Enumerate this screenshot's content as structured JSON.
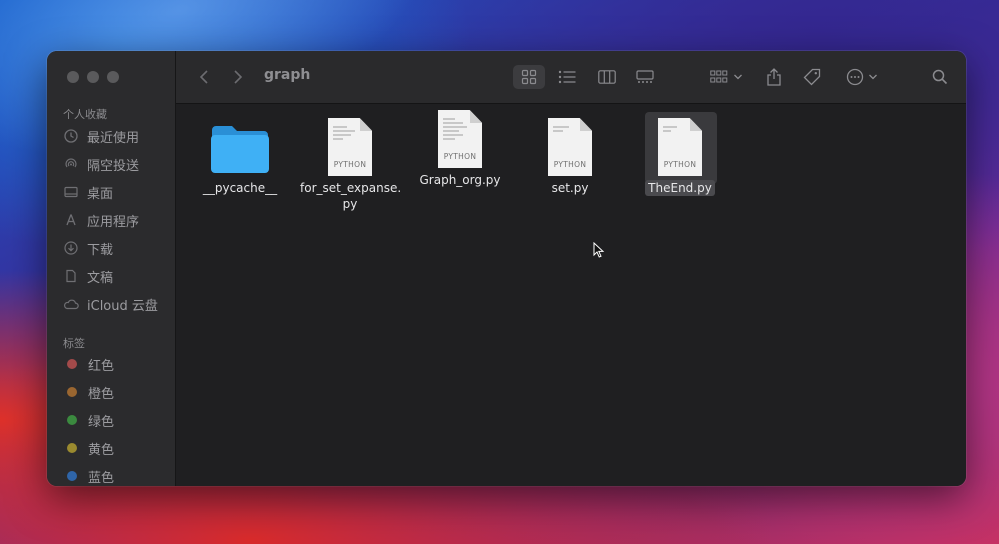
{
  "window": {
    "title": "graph"
  },
  "sidebar": {
    "favorites_title": "个人收藏",
    "favorites": [
      {
        "label": "最近使用",
        "icon": "clock-icon"
      },
      {
        "label": "隔空投送",
        "icon": "airdrop-icon"
      },
      {
        "label": "桌面",
        "icon": "desktop-icon"
      },
      {
        "label": "应用程序",
        "icon": "applications-icon"
      },
      {
        "label": "下载",
        "icon": "download-icon"
      },
      {
        "label": "文稿",
        "icon": "document-icon"
      },
      {
        "label": "iCloud 云盘",
        "icon": "cloud-icon"
      }
    ],
    "tags_title": "标签",
    "tags": [
      {
        "label": "红色",
        "color": "#a34a4a"
      },
      {
        "label": "橙色",
        "color": "#9a6630"
      },
      {
        "label": "绿色",
        "color": "#3b8a3f"
      },
      {
        "label": "黄色",
        "color": "#9a8a2f"
      },
      {
        "label": "蓝色",
        "color": "#2f65a8"
      }
    ]
  },
  "files": [
    {
      "name": "__pycache__",
      "kind": "folder"
    },
    {
      "name": "for_set_expanse.\npy",
      "kind": "python",
      "type_label": "PYTHON"
    },
    {
      "name": "Graph_org.py",
      "kind": "python",
      "type_label": "PYTHON"
    },
    {
      "name": "set.py",
      "kind": "python",
      "type_label": "PYTHON"
    },
    {
      "name": "TheEnd.py",
      "kind": "python",
      "type_label": "PYTHON",
      "selected": true
    }
  ],
  "colors": {
    "folder": "#3fb0f5",
    "accent": "#0a84ff"
  }
}
